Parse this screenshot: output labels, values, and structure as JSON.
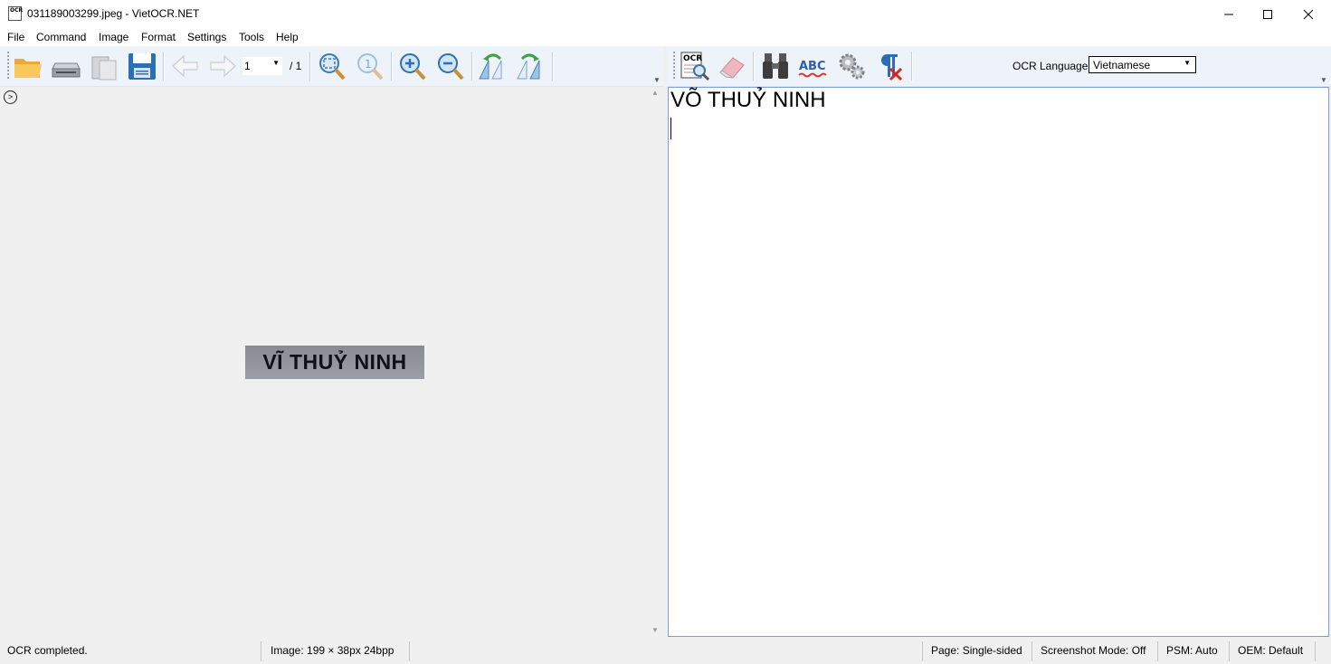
{
  "window": {
    "title": "031189003299.jpeg - VietOCR.NET",
    "app_icon_text": "OCR"
  },
  "menu": {
    "items": [
      "File",
      "Command",
      "Image",
      "Format",
      "Settings",
      "Tools",
      "Help"
    ]
  },
  "left_toolbar": {
    "page_number": "1",
    "page_total": "/ 1",
    "icons": [
      "open-folder-icon",
      "scan-icon",
      "paste-icon",
      "save-icon",
      "previous-page-icon",
      "next-page-icon",
      "fit-image-icon",
      "actual-size-icon",
      "zoom-in-icon",
      "zoom-out-icon",
      "rotate-left-icon",
      "rotate-right-icon"
    ]
  },
  "right_toolbar": {
    "ocr_button_text": "OCR",
    "spellcheck_text": "ABC",
    "icons": [
      "ocr-icon",
      "eraser-icon",
      "binoculars-icon",
      "spellcheck-icon",
      "settings-gears-icon",
      "remove-line-breaks-icon"
    ],
    "ocr_language_label": "OCR Language",
    "ocr_language_value": "Vietnamese"
  },
  "image_pane": {
    "image_text": "VĨ THUỶ NINH"
  },
  "text_pane": {
    "ocr_result": "VÕ THUỶ NINH"
  },
  "status_bar": {
    "message": "OCR completed.",
    "image_info": "Image:  199 × 38px  24bpp",
    "page": "Page:  Single-sided",
    "screenshot_mode": "Screenshot Mode:  Off",
    "psm": "PSM:  Auto",
    "oem": "OEM:  Default"
  },
  "colors": {
    "toolbar_bg": "#eef3f9",
    "text_pane_border": "#7aa0cf",
    "window_bg": "#f0f0f0"
  }
}
